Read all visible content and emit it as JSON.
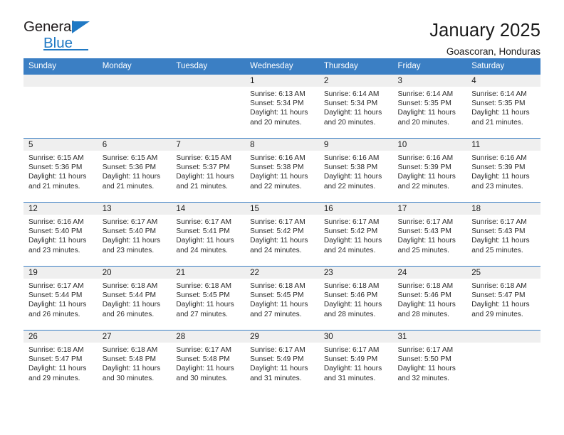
{
  "logo": {
    "word_one": "General",
    "word_two": "Blue",
    "triangle_color": "#2079c4",
    "text_color": "#231f20",
    "accent_color": "#2079c4"
  },
  "header": {
    "title": "January 2025",
    "subtitle": "Goascoran, Honduras"
  },
  "theme": {
    "header_bg": "#3b7fc4",
    "header_text": "#ffffff",
    "daynum_bg": "#efefef",
    "grid_line": "#3b7fc4",
    "body_text": "#2b2b2b"
  },
  "weekdays": [
    "Sunday",
    "Monday",
    "Tuesday",
    "Wednesday",
    "Thursday",
    "Friday",
    "Saturday"
  ],
  "labels": {
    "sunrise_prefix": "Sunrise: ",
    "sunset_prefix": "Sunset: ",
    "daylight_prefix": "Daylight: "
  },
  "weeks": [
    [
      {
        "day": "",
        "sunrise": "",
        "sunset": "",
        "daylight": "",
        "blank": true
      },
      {
        "day": "",
        "sunrise": "",
        "sunset": "",
        "daylight": "",
        "blank": true
      },
      {
        "day": "",
        "sunrise": "",
        "sunset": "",
        "daylight": "",
        "blank": true
      },
      {
        "day": "1",
        "sunrise": "Sunrise: 6:13 AM",
        "sunset": "Sunset: 5:34 PM",
        "daylight": "Daylight: 11 hours and 20 minutes."
      },
      {
        "day": "2",
        "sunrise": "Sunrise: 6:14 AM",
        "sunset": "Sunset: 5:34 PM",
        "daylight": "Daylight: 11 hours and 20 minutes."
      },
      {
        "day": "3",
        "sunrise": "Sunrise: 6:14 AM",
        "sunset": "Sunset: 5:35 PM",
        "daylight": "Daylight: 11 hours and 20 minutes."
      },
      {
        "day": "4",
        "sunrise": "Sunrise: 6:14 AM",
        "sunset": "Sunset: 5:35 PM",
        "daylight": "Daylight: 11 hours and 21 minutes."
      }
    ],
    [
      {
        "day": "5",
        "sunrise": "Sunrise: 6:15 AM",
        "sunset": "Sunset: 5:36 PM",
        "daylight": "Daylight: 11 hours and 21 minutes."
      },
      {
        "day": "6",
        "sunrise": "Sunrise: 6:15 AM",
        "sunset": "Sunset: 5:36 PM",
        "daylight": "Daylight: 11 hours and 21 minutes."
      },
      {
        "day": "7",
        "sunrise": "Sunrise: 6:15 AM",
        "sunset": "Sunset: 5:37 PM",
        "daylight": "Daylight: 11 hours and 21 minutes."
      },
      {
        "day": "8",
        "sunrise": "Sunrise: 6:16 AM",
        "sunset": "Sunset: 5:38 PM",
        "daylight": "Daylight: 11 hours and 22 minutes."
      },
      {
        "day": "9",
        "sunrise": "Sunrise: 6:16 AM",
        "sunset": "Sunset: 5:38 PM",
        "daylight": "Daylight: 11 hours and 22 minutes."
      },
      {
        "day": "10",
        "sunrise": "Sunrise: 6:16 AM",
        "sunset": "Sunset: 5:39 PM",
        "daylight": "Daylight: 11 hours and 22 minutes."
      },
      {
        "day": "11",
        "sunrise": "Sunrise: 6:16 AM",
        "sunset": "Sunset: 5:39 PM",
        "daylight": "Daylight: 11 hours and 23 minutes."
      }
    ],
    [
      {
        "day": "12",
        "sunrise": "Sunrise: 6:16 AM",
        "sunset": "Sunset: 5:40 PM",
        "daylight": "Daylight: 11 hours and 23 minutes."
      },
      {
        "day": "13",
        "sunrise": "Sunrise: 6:17 AM",
        "sunset": "Sunset: 5:40 PM",
        "daylight": "Daylight: 11 hours and 23 minutes."
      },
      {
        "day": "14",
        "sunrise": "Sunrise: 6:17 AM",
        "sunset": "Sunset: 5:41 PM",
        "daylight": "Daylight: 11 hours and 24 minutes."
      },
      {
        "day": "15",
        "sunrise": "Sunrise: 6:17 AM",
        "sunset": "Sunset: 5:42 PM",
        "daylight": "Daylight: 11 hours and 24 minutes."
      },
      {
        "day": "16",
        "sunrise": "Sunrise: 6:17 AM",
        "sunset": "Sunset: 5:42 PM",
        "daylight": "Daylight: 11 hours and 24 minutes."
      },
      {
        "day": "17",
        "sunrise": "Sunrise: 6:17 AM",
        "sunset": "Sunset: 5:43 PM",
        "daylight": "Daylight: 11 hours and 25 minutes."
      },
      {
        "day": "18",
        "sunrise": "Sunrise: 6:17 AM",
        "sunset": "Sunset: 5:43 PM",
        "daylight": "Daylight: 11 hours and 25 minutes."
      }
    ],
    [
      {
        "day": "19",
        "sunrise": "Sunrise: 6:17 AM",
        "sunset": "Sunset: 5:44 PM",
        "daylight": "Daylight: 11 hours and 26 minutes."
      },
      {
        "day": "20",
        "sunrise": "Sunrise: 6:18 AM",
        "sunset": "Sunset: 5:44 PM",
        "daylight": "Daylight: 11 hours and 26 minutes."
      },
      {
        "day": "21",
        "sunrise": "Sunrise: 6:18 AM",
        "sunset": "Sunset: 5:45 PM",
        "daylight": "Daylight: 11 hours and 27 minutes."
      },
      {
        "day": "22",
        "sunrise": "Sunrise: 6:18 AM",
        "sunset": "Sunset: 5:45 PM",
        "daylight": "Daylight: 11 hours and 27 minutes."
      },
      {
        "day": "23",
        "sunrise": "Sunrise: 6:18 AM",
        "sunset": "Sunset: 5:46 PM",
        "daylight": "Daylight: 11 hours and 28 minutes."
      },
      {
        "day": "24",
        "sunrise": "Sunrise: 6:18 AM",
        "sunset": "Sunset: 5:46 PM",
        "daylight": "Daylight: 11 hours and 28 minutes."
      },
      {
        "day": "25",
        "sunrise": "Sunrise: 6:18 AM",
        "sunset": "Sunset: 5:47 PM",
        "daylight": "Daylight: 11 hours and 29 minutes."
      }
    ],
    [
      {
        "day": "26",
        "sunrise": "Sunrise: 6:18 AM",
        "sunset": "Sunset: 5:47 PM",
        "daylight": "Daylight: 11 hours and 29 minutes."
      },
      {
        "day": "27",
        "sunrise": "Sunrise: 6:18 AM",
        "sunset": "Sunset: 5:48 PM",
        "daylight": "Daylight: 11 hours and 30 minutes."
      },
      {
        "day": "28",
        "sunrise": "Sunrise: 6:17 AM",
        "sunset": "Sunset: 5:48 PM",
        "daylight": "Daylight: 11 hours and 30 minutes."
      },
      {
        "day": "29",
        "sunrise": "Sunrise: 6:17 AM",
        "sunset": "Sunset: 5:49 PM",
        "daylight": "Daylight: 11 hours and 31 minutes."
      },
      {
        "day": "30",
        "sunrise": "Sunrise: 6:17 AM",
        "sunset": "Sunset: 5:49 PM",
        "daylight": "Daylight: 11 hours and 31 minutes."
      },
      {
        "day": "31",
        "sunrise": "Sunrise: 6:17 AM",
        "sunset": "Sunset: 5:50 PM",
        "daylight": "Daylight: 11 hours and 32 minutes."
      },
      {
        "day": "",
        "sunrise": "",
        "sunset": "",
        "daylight": "",
        "blank": true
      }
    ]
  ]
}
